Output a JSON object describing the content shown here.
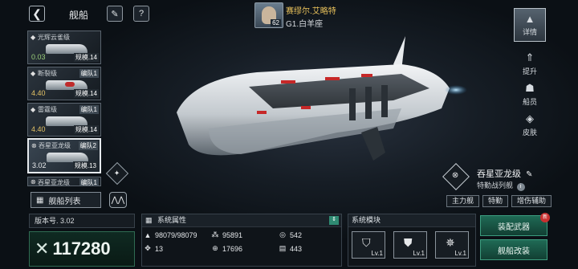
{
  "header": {
    "title": "舰船",
    "commander_name": "赛缪尔.艾略特",
    "commander_level": "62",
    "commander_location": "G1.白羊座"
  },
  "ship_list": [
    {
      "name": "光辉云雀级",
      "value": "0.03",
      "tag": "",
      "scale": "规模.14",
      "selected": false
    },
    {
      "name": "断裂级",
      "value": "4.40",
      "tag": "编队1",
      "scale": "规模.14",
      "selected": false
    },
    {
      "name": "雷霆级",
      "value": "4.40",
      "tag": "编队1",
      "scale": "规模.14",
      "selected": false
    },
    {
      "name": "吞星亚龙级",
      "value": "3.02",
      "tag": "编队2",
      "scale": "规模.13",
      "selected": true
    },
    {
      "name": "吞星亚龙级",
      "value": "",
      "tag": "编队1",
      "scale": "",
      "selected": false
    }
  ],
  "list_button": "舰船列表",
  "side_tabs": [
    "详情",
    "提升",
    "船员",
    "皮肤"
  ],
  "ship": {
    "name": "吞星亚龙级",
    "class": "特勤战列舰",
    "roles": [
      "主力舰",
      "特勤",
      "增伤辅助"
    ]
  },
  "version": "版本号. 3.02",
  "power": "117280",
  "attributes": {
    "title": "系统属性",
    "items": [
      {
        "icon": "hull-icon",
        "value": "98079/98079"
      },
      {
        "icon": "armor-icon",
        "value": "95891"
      },
      {
        "icon": "energy-icon",
        "value": "542"
      },
      {
        "icon": "speed-icon",
        "value": "13"
      },
      {
        "icon": "target-icon",
        "value": "17696"
      },
      {
        "icon": "cargo-icon",
        "value": "443"
      }
    ]
  },
  "modules": {
    "title": "系统模块",
    "items": [
      {
        "icon": "shield-module-icon",
        "level": "Lv.1"
      },
      {
        "icon": "broken-shield-module-icon",
        "level": "Lv.1"
      },
      {
        "icon": "weapon-module-icon",
        "level": "Lv.1"
      }
    ]
  },
  "buttons": {
    "equip": "装配武器",
    "modify": "舰船改装",
    "badge": "新"
  }
}
